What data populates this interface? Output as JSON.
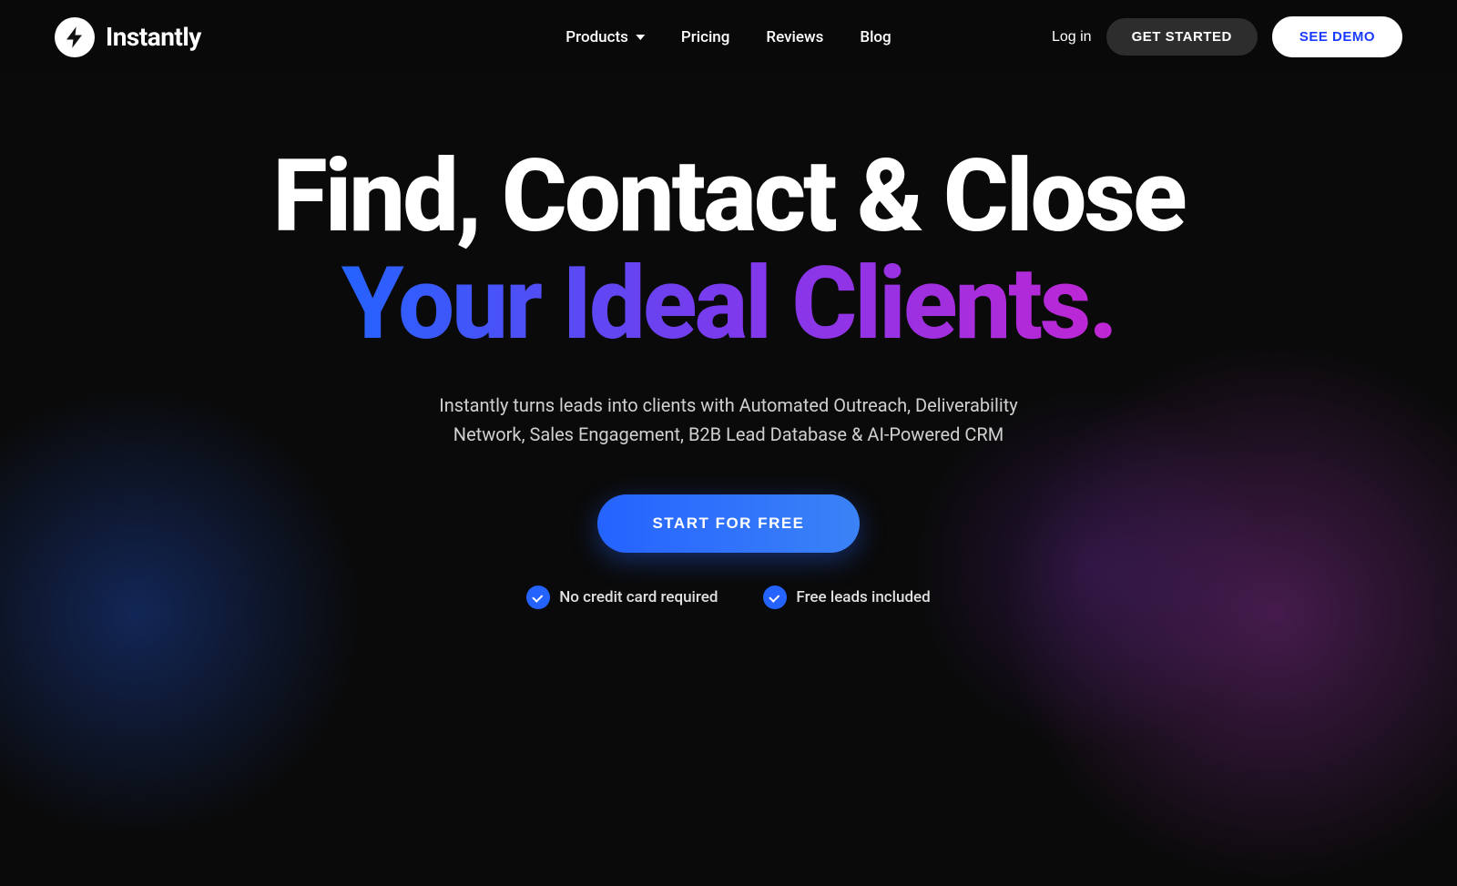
{
  "nav": {
    "logo_text": "Instantly",
    "links": [
      {
        "label": "Products",
        "has_dropdown": true
      },
      {
        "label": "Pricing",
        "has_dropdown": false
      },
      {
        "label": "Reviews",
        "has_dropdown": false
      },
      {
        "label": "Blog",
        "has_dropdown": false
      }
    ],
    "login_label": "Log in",
    "get_started_label": "GET STARTED",
    "see_demo_label": "SEE DEMO"
  },
  "hero": {
    "title_line1": "Find, Contact & Close",
    "title_line2": "Your Ideal Clients.",
    "subtitle": "Instantly turns leads into clients with Automated Outreach, Deliverability Network, Sales Engagement, B2B Lead Database & AI-Powered CRM",
    "cta_label": "START FOR FREE",
    "badge1": "No credit card required",
    "badge2": "Free leads included"
  }
}
